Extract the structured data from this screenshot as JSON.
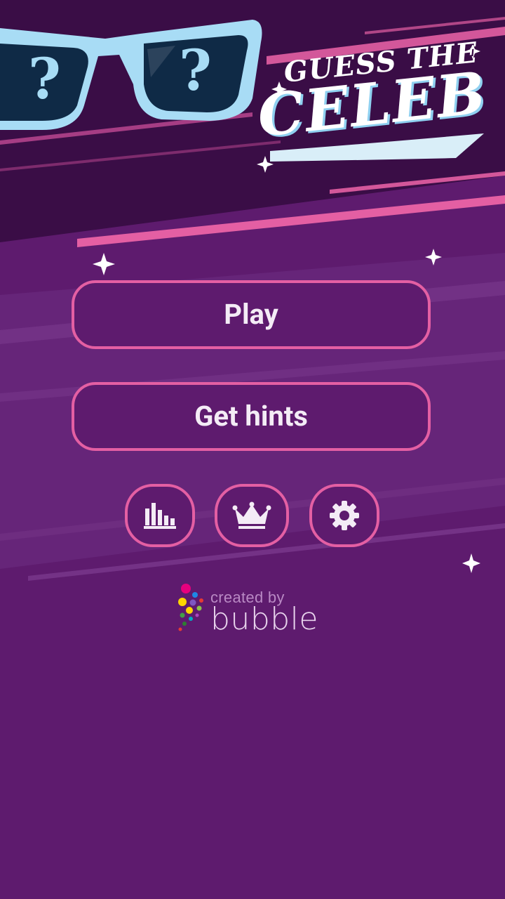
{
  "colors": {
    "background": "#5e1b6e",
    "banner": "#3a0d46",
    "accent_pink": "#e45fa3",
    "glasses_frame": "#a8dcf5",
    "button_text": "#f4ecf6"
  },
  "header": {
    "title_small": "GUESS THE",
    "title_big": "CELEB",
    "glasses_marks": [
      "?",
      "?"
    ]
  },
  "menu": {
    "play_label": "Play",
    "hints_label": "Get hints",
    "icon_buttons": [
      {
        "name": "stats",
        "icon": "bar-chart-icon"
      },
      {
        "name": "leaderboard",
        "icon": "crown-icon"
      },
      {
        "name": "settings",
        "icon": "gear-icon"
      }
    ]
  },
  "branding": {
    "created_by": "created by",
    "name": "bubble"
  }
}
